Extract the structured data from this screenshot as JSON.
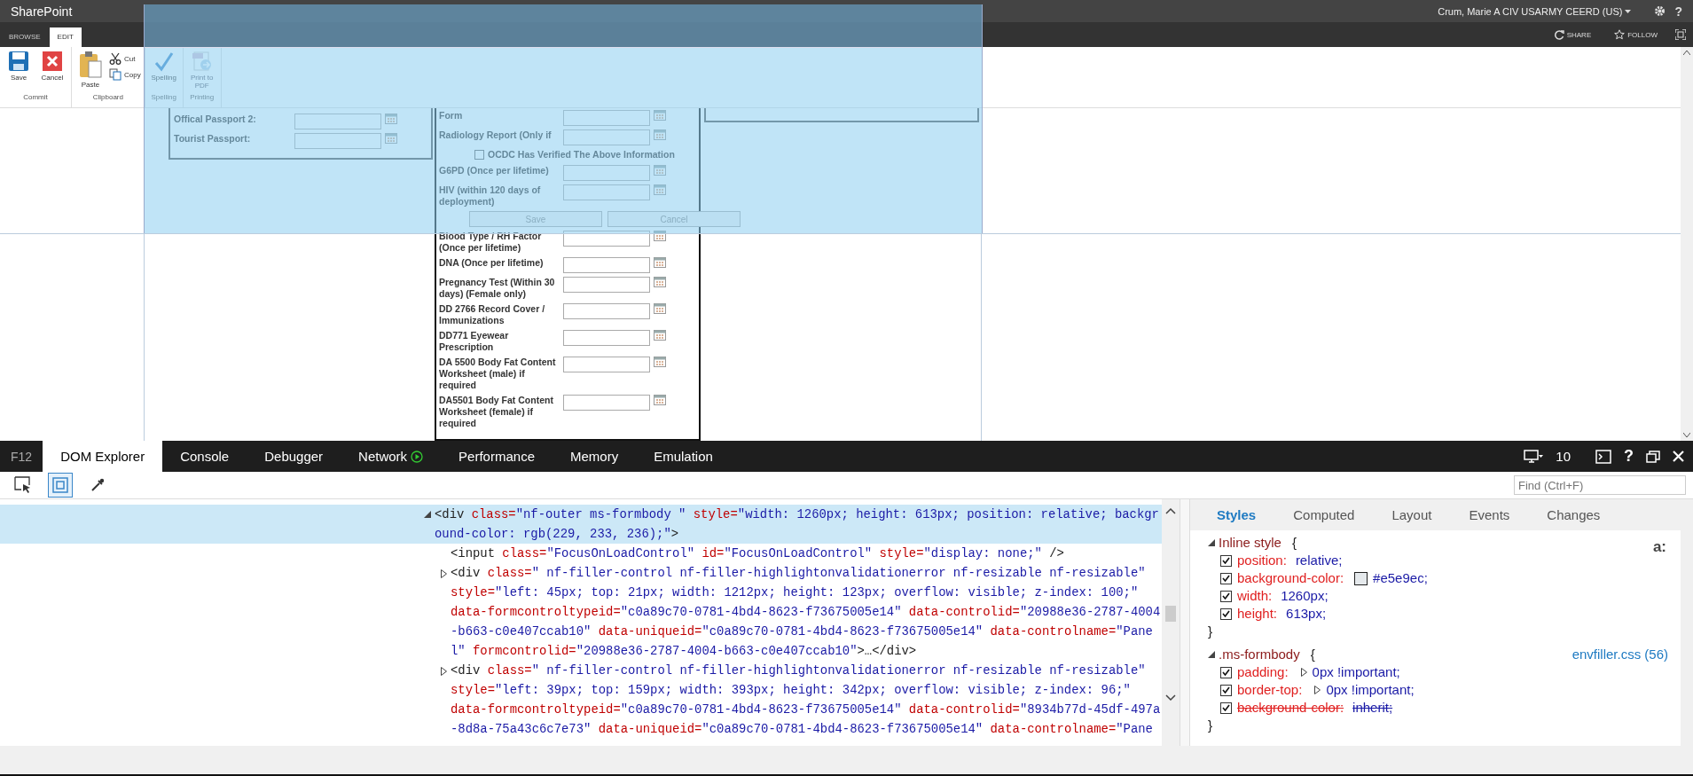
{
  "app": {
    "title": "SharePoint",
    "user": "Crum, Marie A CIV USARMY CEERD (US)",
    "help": "?",
    "tabs": [
      {
        "label": "BROWSE",
        "selected": false
      },
      {
        "label": "EDIT",
        "selected": true
      }
    ],
    "actions": [
      "SHARE",
      "FOLLOW"
    ]
  },
  "ribbon": {
    "groups": [
      {
        "label": "Commit",
        "buttons": [
          {
            "label": "Save",
            "disabled": false
          },
          {
            "label": "Cancel",
            "disabled": false
          }
        ]
      },
      {
        "label": "Clipboard",
        "buttons": [
          {
            "label": "Paste",
            "disabled": false
          }
        ],
        "small_buttons": [
          "Cut",
          "Copy"
        ]
      },
      {
        "label": "Spelling",
        "buttons": [
          {
            "label": "Spelling",
            "disabled": false
          }
        ]
      },
      {
        "label": "Printing",
        "buttons": [
          {
            "label": "Print to PDF",
            "disabled": true
          }
        ]
      }
    ]
  },
  "form": {
    "left_panel": {
      "fields": [
        {
          "label": "Offical Passport 2:"
        },
        {
          "label": "Tourist Passport:"
        }
      ]
    },
    "middle_panel": {
      "items": [
        {
          "kind": "field",
          "label": "Form"
        },
        {
          "kind": "field",
          "label": "Radiology Report (Only if"
        },
        {
          "kind": "checkbox",
          "label": "OCDC Has Verified The Above Information",
          "checked": false
        },
        {
          "kind": "field",
          "label": "G6PD (Once per lifetime)"
        },
        {
          "kind": "field",
          "label": "HIV (within 120 days of deployment)"
        },
        {
          "kind": "buttons",
          "labels": [
            "Save",
            "Cancel"
          ]
        },
        {
          "kind": "field",
          "label": "Blood Type / RH Factor (Once per lifetime)"
        },
        {
          "kind": "field",
          "label": "DNA (Once per lifetime)"
        },
        {
          "kind": "field",
          "label": "Pregnancy Test (Within 30 days) (Female only)"
        },
        {
          "kind": "field",
          "label": "DD 2766 Record Cover / Immunizations"
        },
        {
          "kind": "field",
          "label": "DD771 Eyewear Prescription"
        },
        {
          "kind": "field",
          "label": "DA 5500 Body Fat Content Worksheet (male) if required"
        },
        {
          "kind": "field",
          "label": "DA5501 Body Fat Content Worksheet (female) if required"
        }
      ]
    }
  },
  "devtools": {
    "label": "F12",
    "version": "10",
    "help": "?",
    "tabs": [
      {
        "label": "DOM Explorer",
        "selected": true
      },
      {
        "label": "Console",
        "selected": false
      },
      {
        "label": "Debugger",
        "selected": false
      },
      {
        "label": "Network",
        "selected": false
      },
      {
        "label": "Performance",
        "selected": false
      },
      {
        "label": "Memory",
        "selected": false
      },
      {
        "label": "Emulation",
        "selected": false
      }
    ],
    "tools": [
      {
        "selected": false
      },
      {
        "selected": true
      },
      {
        "selected": false
      }
    ],
    "find": {
      "placeholder": "Find (Ctrl+F)"
    },
    "dom": {
      "nodes": [
        {
          "kind": "element",
          "expanded": true,
          "selected": true,
          "lines": [
            [
              {
                "kind": "tag",
                "text": "<div"
              },
              {
                "kind": "attr",
                "text": " class="
              },
              {
                "kind": "val",
                "text": "\"nf-outer ms-formbody \""
              },
              {
                "kind": "attr",
                "text": " style="
              },
              {
                "kind": "val",
                "text": "\"width: 1260px; height: 613px; position: relative; backgr"
              }
            ],
            [
              {
                "kind": "val",
                "text": "ound-color: rgb(229, 233, 236);\""
              },
              {
                "kind": "tag",
                "text": ">"
              }
            ]
          ],
          "children": [
            {
              "kind": "leaf",
              "selected": false,
              "lines": [
                [
                  {
                    "kind": "tag",
                    "text": "<input"
                  },
                  {
                    "kind": "attr",
                    "text": " class="
                  },
                  {
                    "kind": "val",
                    "text": "\"FocusOnLoadControl\""
                  },
                  {
                    "kind": "attr",
                    "text": " id="
                  },
                  {
                    "kind": "val",
                    "text": "\"FocusOnLoadControl\""
                  },
                  {
                    "kind": "attr",
                    "text": " style="
                  },
                  {
                    "kind": "val",
                    "text": "\"display: none;\""
                  },
                  {
                    "kind": "tag",
                    "text": " />"
                  }
                ]
              ]
            },
            {
              "kind": "element",
              "expanded": false,
              "selected": false,
              "lines": [
                [
                  {
                    "kind": "tag",
                    "text": "<div"
                  },
                  {
                    "kind": "attr",
                    "text": " class="
                  },
                  {
                    "kind": "val",
                    "text": "\" nf-filler-control nf-filler-highlightonvalidationerror nf-resizable nf-resizable\""
                  }
                ],
                [
                  {
                    "kind": "attr",
                    "text": "style="
                  },
                  {
                    "kind": "val",
                    "text": "\"left: 45px; top: 21px; width: 1212px; height: 123px; overflow: visible; z-index: 100;\""
                  }
                ],
                [
                  {
                    "kind": "attr",
                    "text": "data-formcontroltypeid="
                  },
                  {
                    "kind": "val",
                    "text": "\"c0a89c70-0781-4bd4-8623-f73675005e14\""
                  },
                  {
                    "kind": "attr",
                    "text": " data-controlid="
                  },
                  {
                    "kind": "val",
                    "text": "\"20988e36-2787-4004"
                  }
                ],
                [
                  {
                    "kind": "val",
                    "text": "-b663-c0e407ccab10\""
                  },
                  {
                    "kind": "attr",
                    "text": " data-uniqueid="
                  },
                  {
                    "kind": "val",
                    "text": "\"c0a89c70-0781-4bd4-8623-f73675005e14\""
                  },
                  {
                    "kind": "attr",
                    "text": " data-controlname="
                  },
                  {
                    "kind": "val",
                    "text": "\"Pane"
                  }
                ],
                [
                  {
                    "kind": "val",
                    "text": "l\""
                  },
                  {
                    "kind": "attr",
                    "text": " formcontrolid="
                  },
                  {
                    "kind": "val",
                    "text": "\"20988e36-2787-4004-b663-c0e407ccab10\""
                  },
                  {
                    "kind": "tag",
                    "text": ">…</div>"
                  }
                ]
              ]
            },
            {
              "kind": "element",
              "expanded": false,
              "selected": false,
              "lines": [
                [
                  {
                    "kind": "tag",
                    "text": "<div"
                  },
                  {
                    "kind": "attr",
                    "text": " class="
                  },
                  {
                    "kind": "val",
                    "text": "\" nf-filler-control nf-filler-highlightonvalidationerror nf-resizable nf-resizable\""
                  }
                ],
                [
                  {
                    "kind": "attr",
                    "text": "style="
                  },
                  {
                    "kind": "val",
                    "text": "\"left: 39px; top: 159px; width: 393px; height: 342px; overflow: visible; z-index: 96;\""
                  }
                ],
                [
                  {
                    "kind": "attr",
                    "text": "data-formcontroltypeid="
                  },
                  {
                    "kind": "val",
                    "text": "\"c0a89c70-0781-4bd4-8623-f73675005e14\""
                  },
                  {
                    "kind": "attr",
                    "text": " data-controlid="
                  },
                  {
                    "kind": "val",
                    "text": "\"8934b77d-45df-497a"
                  }
                ],
                [
                  {
                    "kind": "val",
                    "text": "-8d8a-75a43c6c7e73\""
                  },
                  {
                    "kind": "attr",
                    "text": " data-uniqueid="
                  },
                  {
                    "kind": "val",
                    "text": "\"c0a89c70-0781-4bd4-8623-f73675005e14\""
                  },
                  {
                    "kind": "attr",
                    "text": " data-controlname="
                  },
                  {
                    "kind": "val",
                    "text": "\"Pane"
                  }
                ]
              ]
            }
          ]
        }
      ]
    },
    "styles": {
      "tabs": [
        {
          "label": "Styles",
          "selected": true
        },
        {
          "label": "Computed",
          "selected": false
        },
        {
          "label": "Layout",
          "selected": false
        },
        {
          "label": "Events",
          "selected": false
        },
        {
          "label": "Changes",
          "selected": false
        }
      ],
      "pseudo_toggle": "a:",
      "rules": [
        {
          "selector": "Inline style",
          "open": "{",
          "close": "}",
          "props": [
            {
              "name": "position:",
              "value": "relative;",
              "checked": true,
              "overridden": false
            },
            {
              "name": "background-color:",
              "value": "#e5e9ec;",
              "color": "#e5e9ec",
              "checked": true,
              "overridden": false
            },
            {
              "name": "width:",
              "value": "1260px;",
              "checked": true,
              "overridden": false
            },
            {
              "name": "height:",
              "value": "613px;",
              "checked": true,
              "overridden": false
            }
          ]
        },
        {
          "selector": ".ms-formbody",
          "source": "envfiller.css (56)",
          "open": "{",
          "close": "}",
          "props": [
            {
              "name": "padding:",
              "value": "0px !important;",
              "checked": true,
              "overridden": false,
              "expandable": true
            },
            {
              "name": "border-top:",
              "value": "0px !important;",
              "checked": true,
              "overridden": false,
              "expandable": true
            },
            {
              "name": "background-color:",
              "value": "inherit;",
              "checked": true,
              "overridden": true
            }
          ]
        }
      ]
    }
  }
}
